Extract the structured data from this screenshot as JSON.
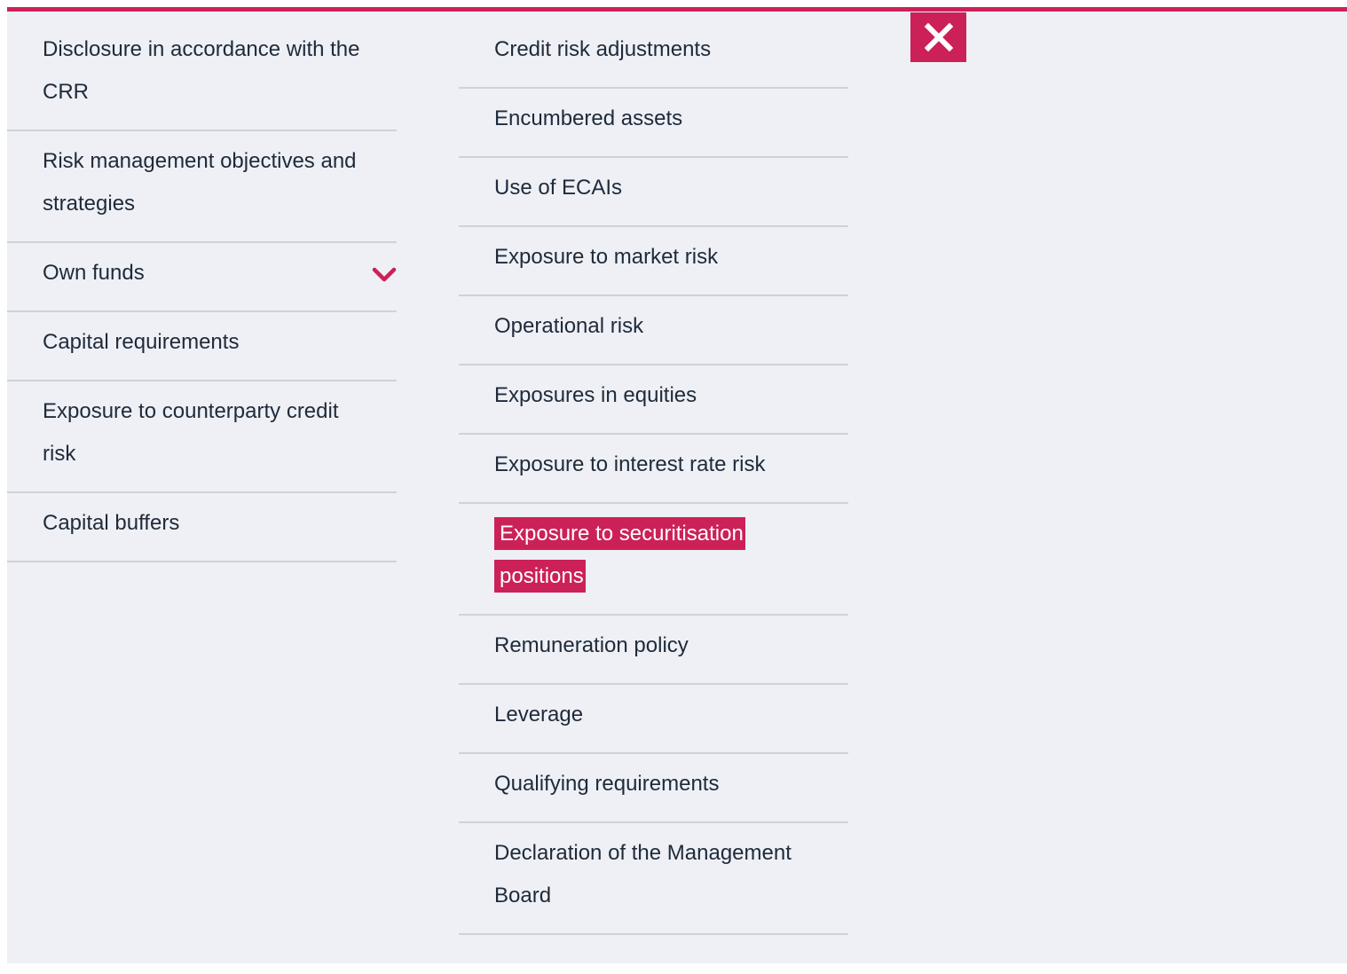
{
  "colors": {
    "accent": "#cc2158",
    "panel_background": "#eef0f5",
    "divider": "#cfd2d9",
    "text": "#1f2a3a"
  },
  "left_menu": {
    "items": [
      {
        "label": "Disclosure in accordance with the CRR"
      },
      {
        "label": "Risk management objectives and strategies"
      },
      {
        "label": "Own funds",
        "expandable": true,
        "icon": "chevron-down-icon"
      },
      {
        "label": "Capital requirements"
      },
      {
        "label": "Exposure to counterparty credit risk"
      },
      {
        "label": "Capital buffers"
      }
    ]
  },
  "right_menu": {
    "items": [
      {
        "label": "Credit risk adjustments"
      },
      {
        "label": "Encumbered assets"
      },
      {
        "label": "Use of ECAIs"
      },
      {
        "label": "Exposure to market risk"
      },
      {
        "label": "Operational risk"
      },
      {
        "label": "Exposures in equities"
      },
      {
        "label": "Exposure to interest rate risk"
      },
      {
        "label": "Exposure to securitisation positions",
        "active": true
      },
      {
        "label": "Remuneration policy"
      },
      {
        "label": "Leverage"
      },
      {
        "label": "Qualifying requirements"
      },
      {
        "label": "Declaration of the Management Board"
      }
    ]
  },
  "close_button": {
    "icon": "close-icon"
  }
}
